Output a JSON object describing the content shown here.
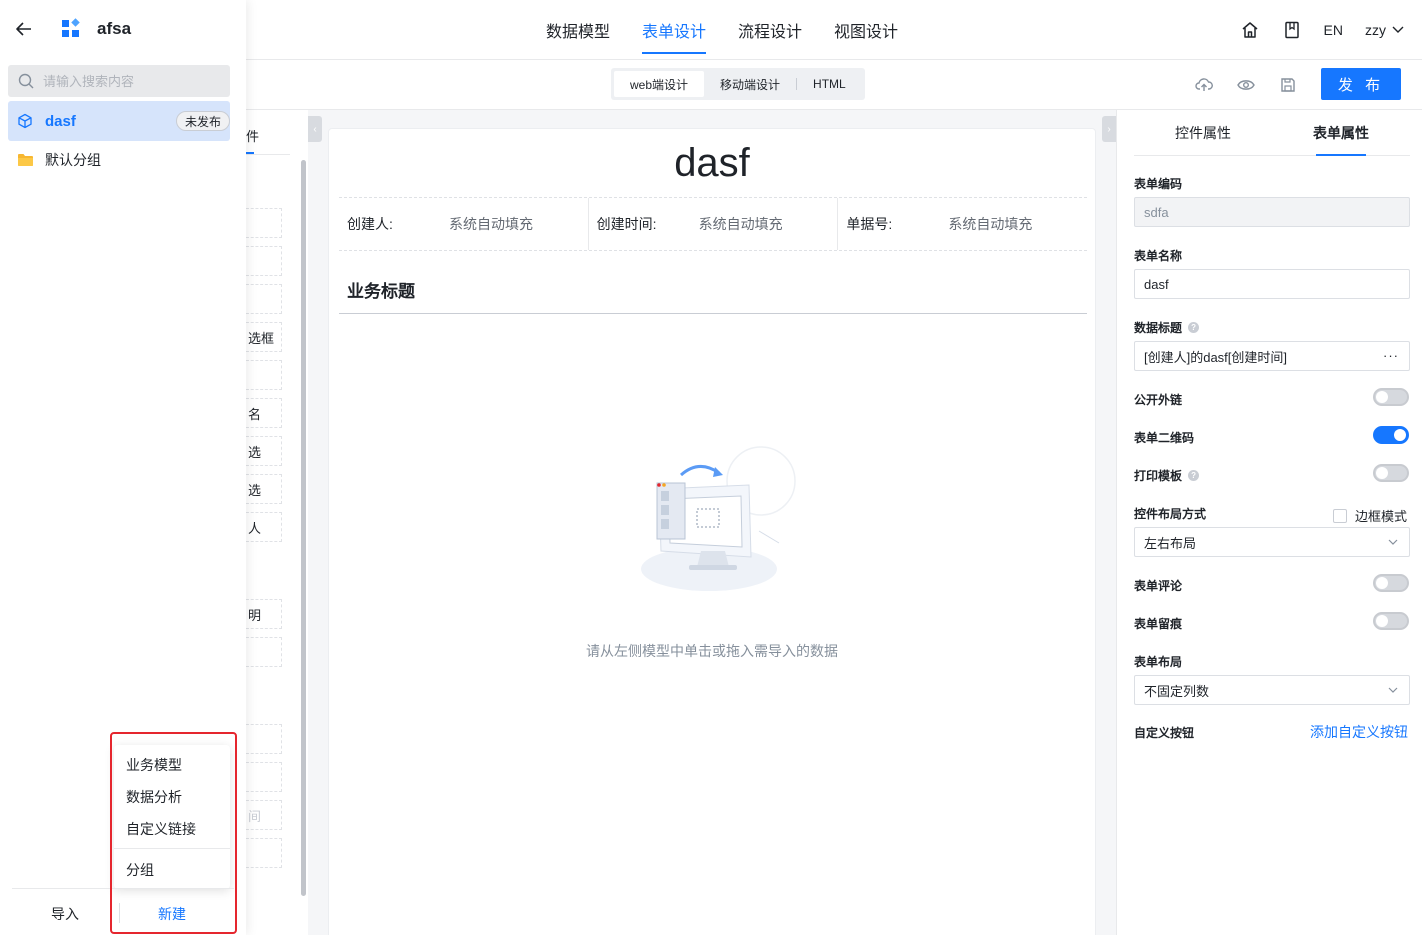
{
  "nav": {
    "tabs": [
      "数据模型",
      "表单设计",
      "流程设计",
      "视图设计"
    ],
    "active": "表单设计",
    "lang": "EN",
    "user": "zzy"
  },
  "toolbar": {
    "modes": [
      "web端设计",
      "移动端设计",
      "HTML"
    ],
    "active_mode": "web端设计",
    "publish_label": "发 布"
  },
  "drawer": {
    "app_name": "afsa",
    "search_placeholder": "请输入搜索内容",
    "selected_item": {
      "name": "dasf",
      "badge": "未发布"
    },
    "group": "默认分组",
    "import_label": "导入",
    "new_label": "新建",
    "new_menu": [
      "业务模型",
      "数据分析",
      "自定义链接",
      "分组"
    ]
  },
  "widget_panel": {
    "tab_fragment": "件",
    "items": [
      "",
      "",
      "",
      "选框",
      "",
      "名",
      "选",
      "选",
      "人",
      "明",
      "",
      "",
      "",
      "间",
      ""
    ]
  },
  "canvas": {
    "form_title": "dasf",
    "meta": [
      {
        "label": "创建人:",
        "value": "系统自动填充"
      },
      {
        "label": "创建时间:",
        "value": "系统自动填充"
      },
      {
        "label": "单据号:",
        "value": "系统自动填充"
      }
    ],
    "section_title": "业务标题",
    "empty_hint": "请从左侧模型中单击或拖入需导入的数据"
  },
  "props": {
    "tabs": [
      "控件属性",
      "表单属性"
    ],
    "active_tab": "表单属性",
    "form_code_label": "表单编码",
    "form_code": "sdfa",
    "form_name_label": "表单名称",
    "form_name": "dasf",
    "data_title_label": "数据标题",
    "data_title": "[创建人]的dasf[创建时间]",
    "public_link_label": "公开外链",
    "public_link": false,
    "qrcode_label": "表单二维码",
    "qrcode": true,
    "print_label": "打印模板",
    "print": false,
    "layout_mode_label": "控件布局方式",
    "border_mode_label": "边框模式",
    "layout_mode": "左右布局",
    "comment_label": "表单评论",
    "comment": false,
    "trace_label": "表单留痕",
    "trace": false,
    "form_layout_label": "表单布局",
    "form_layout": "不固定列数",
    "custom_btn_label": "自定义按钮",
    "custom_btn_link": "添加自定义按钮"
  }
}
